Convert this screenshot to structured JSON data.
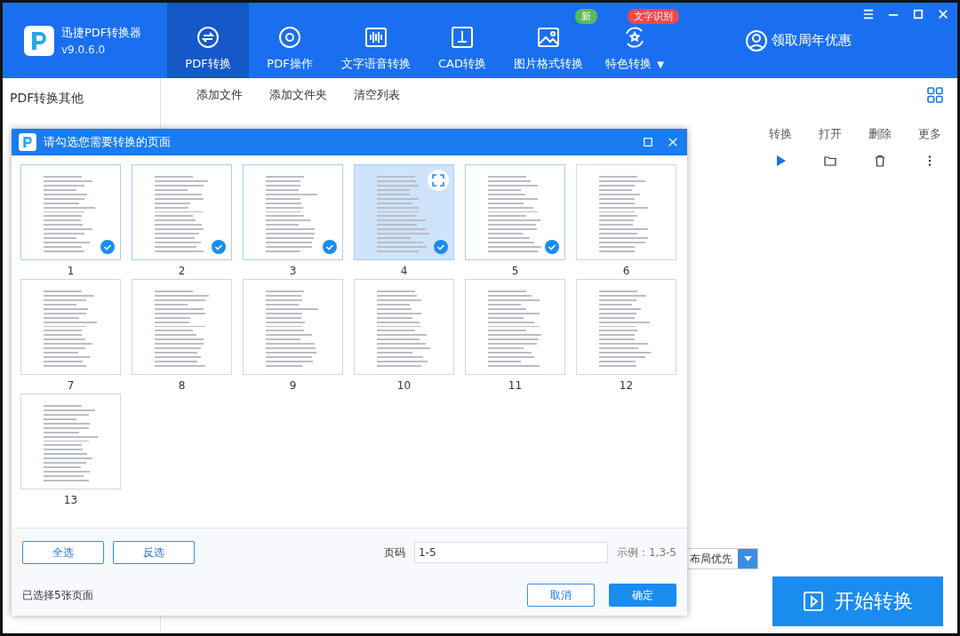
{
  "app": {
    "name": "迅捷PDF转换器",
    "version": "v9.0.6.0"
  },
  "nav": [
    {
      "label": "PDF转换",
      "selected": true
    },
    {
      "label": "PDF操作",
      "selected": false
    },
    {
      "label": "文字语音转换",
      "selected": false
    },
    {
      "label": "CAD转换",
      "selected": false
    },
    {
      "label": "图片格式转换",
      "selected": false,
      "badge": "新",
      "color": "#5cb85c"
    },
    {
      "label": "特色转换",
      "selected": false,
      "badge": "文字识别",
      "color": "#f04848",
      "dropdown": "▼"
    }
  ],
  "promo": "领取周年优惠",
  "sidebar": {
    "title": "PDF转换其他"
  },
  "toolbar": [
    "添加文件",
    "添加文件夹",
    "清空列表"
  ],
  "table": {
    "columns": [
      "转换",
      "打开",
      "删除",
      "更多"
    ]
  },
  "layout_select": "布局优先",
  "start_button": "开始转换",
  "dialog": {
    "title": "请勾选您需要转换的页面",
    "pages": [
      {
        "label": "1",
        "selected": true,
        "hovered": false
      },
      {
        "label": "2",
        "selected": true,
        "hovered": false
      },
      {
        "label": "3",
        "selected": true,
        "hovered": false
      },
      {
        "label": "4",
        "selected": true,
        "hovered": true
      },
      {
        "label": "5",
        "selected": true,
        "hovered": false
      },
      {
        "label": "6",
        "selected": false,
        "hovered": false
      },
      {
        "label": "7",
        "selected": false,
        "hovered": false
      },
      {
        "label": "8",
        "selected": false,
        "hovered": false
      },
      {
        "label": "9",
        "selected": false,
        "hovered": false
      },
      {
        "label": "10",
        "selected": false,
        "hovered": false
      },
      {
        "label": "11",
        "selected": false,
        "hovered": false
      },
      {
        "label": "12",
        "selected": false,
        "hovered": false
      },
      {
        "label": "13",
        "selected": false,
        "hovered": false
      }
    ],
    "select_all": "全选",
    "invert": "反选",
    "page_label": "页码",
    "page_value": "1-5",
    "example": "示例：1,3-5",
    "status": "已选择5张页面",
    "cancel": "取消",
    "ok": "确定"
  }
}
